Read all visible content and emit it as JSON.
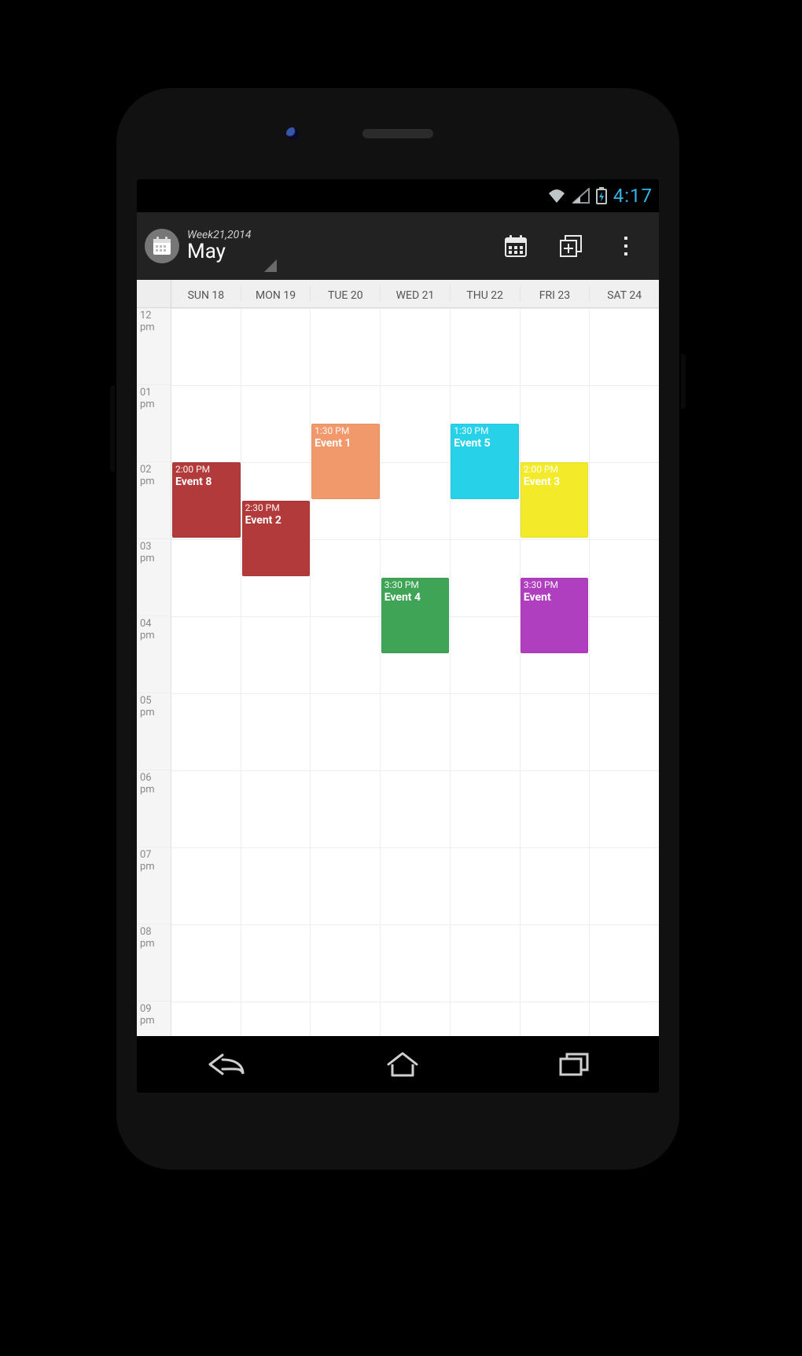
{
  "status": {
    "time": "4:17"
  },
  "actionbar": {
    "subtitle": "Week21,2014",
    "title": "May"
  },
  "days": [
    {
      "label": "SUN 18"
    },
    {
      "label": "MON 19"
    },
    {
      "label": "TUE 20"
    },
    {
      "label": "WED 21"
    },
    {
      "label": "THU 22"
    },
    {
      "label": "FRI 23"
    },
    {
      "label": "SAT 24"
    }
  ],
  "hours": [
    {
      "hr": "12",
      "ap": "pm"
    },
    {
      "hr": "01",
      "ap": "pm"
    },
    {
      "hr": "02",
      "ap": "pm"
    },
    {
      "hr": "03",
      "ap": "pm"
    },
    {
      "hr": "04",
      "ap": "pm"
    },
    {
      "hr": "05",
      "ap": "pm"
    },
    {
      "hr": "06",
      "ap": "pm"
    },
    {
      "hr": "07",
      "ap": "pm"
    },
    {
      "hr": "08",
      "ap": "pm"
    },
    {
      "hr": "09",
      "ap": "pm"
    }
  ],
  "grid": {
    "startHour": 12,
    "hourHeight": 98,
    "cols": 7
  },
  "events": [
    {
      "day": 0,
      "startHour": 14.0,
      "durHours": 1.0,
      "color": "#b23a3a",
      "time": "2:00 PM",
      "name": "Event 8"
    },
    {
      "day": 1,
      "startHour": 14.5,
      "durHours": 1.0,
      "color": "#b23a3a",
      "time": "2:30 PM",
      "name": "Event 2"
    },
    {
      "day": 2,
      "startHour": 13.5,
      "durHours": 1.0,
      "color": "#f2996b",
      "time": "1:30 PM",
      "name": "Event 1"
    },
    {
      "day": 3,
      "startHour": 15.5,
      "durHours": 1.0,
      "color": "#3fa456",
      "time": "3:30 PM",
      "name": "Event 4"
    },
    {
      "day": 4,
      "startHour": 13.5,
      "durHours": 1.0,
      "color": "#27d2e8",
      "time": "1:30 PM",
      "name": "Event 5"
    },
    {
      "day": 5,
      "startHour": 14.0,
      "durHours": 1.0,
      "color": "#f3eb2a",
      "time": "2:00 PM",
      "name": "Event 3"
    },
    {
      "day": 5,
      "startHour": 15.5,
      "durHours": 1.0,
      "color": "#b03fbf",
      "time": "3:30 PM",
      "name": "Event"
    }
  ]
}
